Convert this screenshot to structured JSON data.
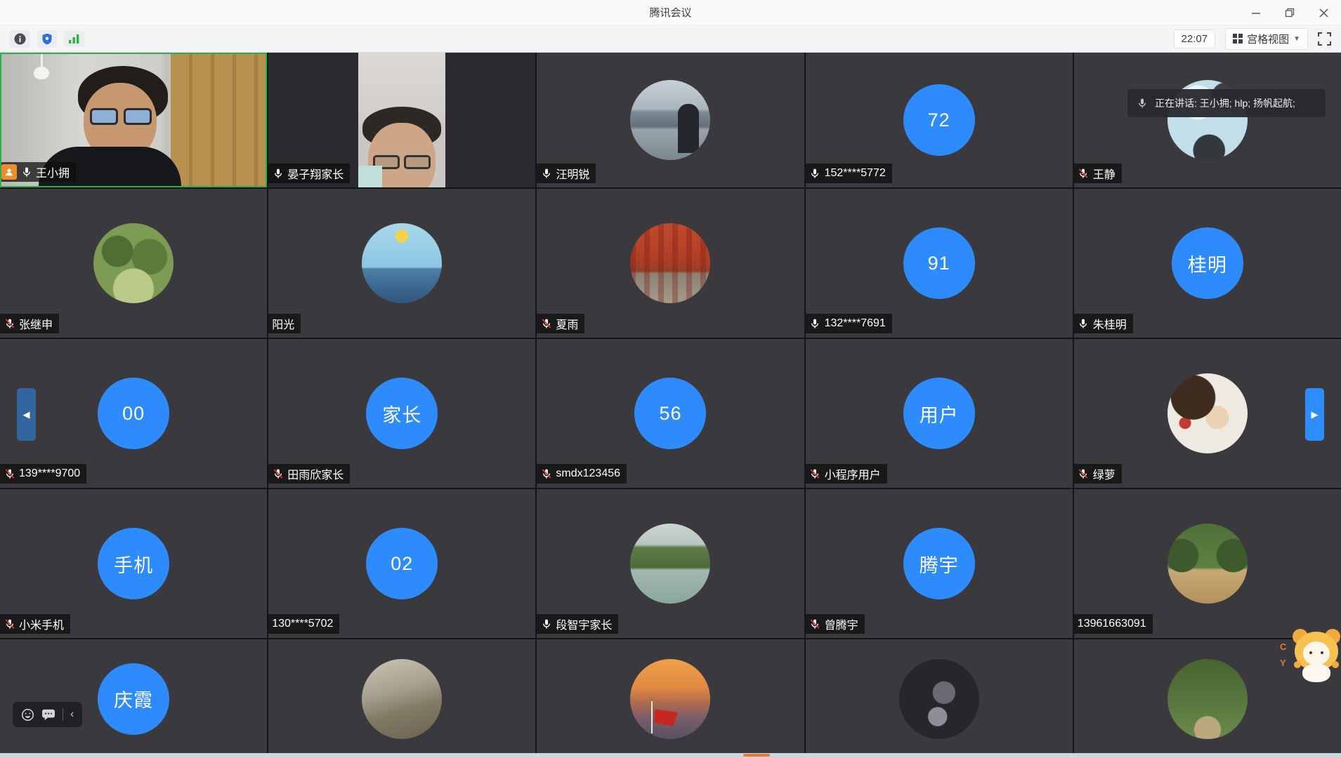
{
  "window": {
    "title": "腾讯会议"
  },
  "toolbar": {
    "time": "22:07",
    "view_label": "宫格视图",
    "left_icons": [
      "meeting-info",
      "security-shield",
      "network-signal"
    ]
  },
  "banner": {
    "text": "正在讲话: 王小拥; hlp; 扬帆起航;"
  },
  "colors": {
    "accent_blue": "#2e8bfc",
    "active_green": "#2fae4e",
    "mute_red": "#e0392f",
    "host_orange": "#f08c2e"
  },
  "sticker": {
    "letters": [
      "C",
      "Y"
    ]
  },
  "participants": [
    {
      "name": "王小拥",
      "mic": "on",
      "host": true,
      "active": true,
      "type": "video",
      "variant": "v-man"
    },
    {
      "name": "晏子翔家长",
      "mic": "on",
      "type": "video",
      "variant": "v-woman"
    },
    {
      "name": "汪明锐",
      "mic": "on",
      "type": "avatar",
      "variant": "city"
    },
    {
      "name": "152****5772",
      "mic": "on",
      "type": "initials",
      "text": "72"
    },
    {
      "name": "王静",
      "mic": "muted",
      "type": "avatar",
      "variant": "fishbowl"
    },
    {
      "name": "张继申",
      "mic": "muted",
      "type": "avatar",
      "variant": "park"
    },
    {
      "name": "阳光",
      "mic": "none",
      "type": "avatar",
      "variant": "sea-morning"
    },
    {
      "name": "夏雨",
      "mic": "muted",
      "type": "avatar",
      "variant": "autumn"
    },
    {
      "name": "132****7691",
      "mic": "on",
      "type": "initials",
      "text": "91"
    },
    {
      "name": "朱桂明",
      "mic": "on",
      "type": "initials",
      "text": "桂明"
    },
    {
      "name": "139****9700",
      "mic": "muted",
      "type": "initials",
      "text": "00"
    },
    {
      "name": "田雨欣家长",
      "mic": "muted",
      "type": "initials",
      "text": "家长"
    },
    {
      "name": "smdx123456",
      "mic": "muted",
      "type": "initials",
      "text": "56"
    },
    {
      "name": "小程序用户",
      "mic": "muted",
      "type": "initials",
      "text": "用户"
    },
    {
      "name": "绿萝",
      "mic": "muted",
      "type": "avatar",
      "variant": "anime-girl"
    },
    {
      "name": "小米手机",
      "mic": "muted",
      "type": "initials",
      "text": "手机"
    },
    {
      "name": "130****5702",
      "mic": "none",
      "type": "initials",
      "text": "02"
    },
    {
      "name": "段智宇家长",
      "mic": "on",
      "type": "avatar",
      "variant": "mountains-river"
    },
    {
      "name": "曾腾宇",
      "mic": "muted",
      "type": "initials",
      "text": "腾宇"
    },
    {
      "name": "13961663091",
      "mic": "none",
      "type": "avatar",
      "variant": "forest-path"
    },
    {
      "type": "initials",
      "text": "庆霞"
    },
    {
      "type": "avatar",
      "variant": "rocky-mountain"
    },
    {
      "type": "avatar",
      "variant": "sunset-flag"
    },
    {
      "type": "avatar",
      "variant": "dark-desk"
    },
    {
      "type": "avatar",
      "variant": "forest-person"
    }
  ]
}
